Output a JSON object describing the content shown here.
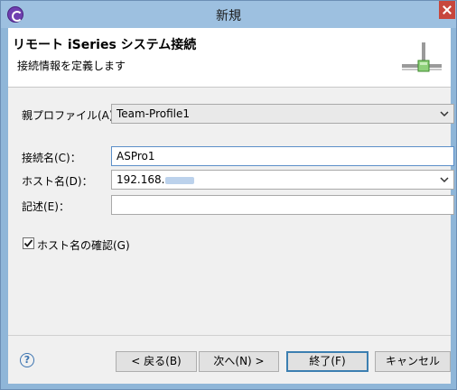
{
  "window": {
    "title": "新規"
  },
  "banner": {
    "title": "リモート iSeries システム接続",
    "subtitle": "接続情報を定義します"
  },
  "form": {
    "profile_label": "親プロファイル(A)：",
    "profile_value": "Team-Profile1",
    "connection_label": "接続名(C)：",
    "connection_value": "ASPro1",
    "host_label": "ホスト名(D)：",
    "host_value": "192.168.",
    "description_label": "記述(E)：",
    "description_value": "",
    "verify_host_label": "ホスト名の確認(G)",
    "verify_host_checked": true
  },
  "buttons": {
    "back": "< 戻る(B)",
    "next": "次へ(N) >",
    "finish": "終了(F)",
    "cancel": "キャンセル"
  },
  "icons": {
    "app": "eclipse-icon",
    "close": "close-icon",
    "help": "help-icon",
    "banner": "network-connection-icon"
  },
  "colors": {
    "titlebar": "#9dc0e0",
    "close": "#c7473d",
    "dialog_bg": "#f0f0f0",
    "focus_border": "#5c8fc9"
  }
}
